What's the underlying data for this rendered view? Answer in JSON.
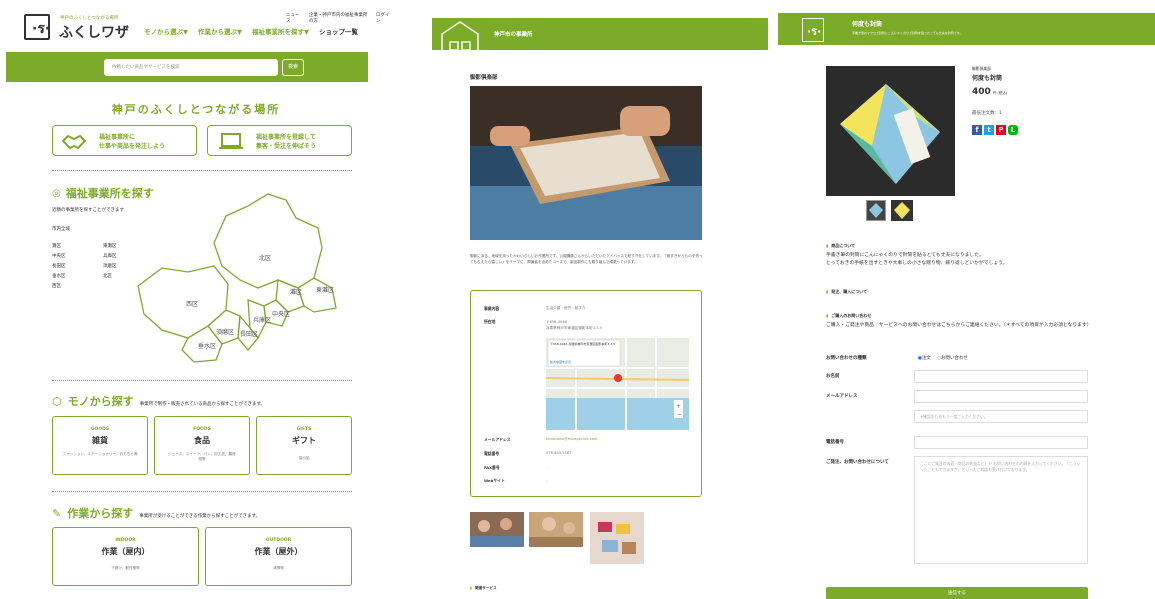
{
  "home": {
    "logo_caption": "神戸のふくしとつながる場所",
    "logo_text": "ふくしワザ",
    "util_links": [
      "ニュース",
      "企業・神戸市内の福祉事業所の方",
      "ログイン"
    ],
    "nav": [
      "モノから選ぶ",
      "作業から選ぶ",
      "福祉事業所を探す",
      "ショップ一覧"
    ],
    "search_placeholder": "依頼したい商品やサービスを検索",
    "search_button": "検索",
    "tagline": "神戸のふくしとつながる場所",
    "cta1": {
      "line1": "福祉事業所に",
      "line2": "仕事や商品を発注しよう"
    },
    "cta2": {
      "line1": "福祉事業所を登録して",
      "line2": "集客・受注を伸ばそう"
    },
    "find_office_title": "福祉事業所を探す",
    "find_office_sub": "近隣の事業所を探すことができます",
    "city_all": "市内全域",
    "wards_col1": [
      "灘区",
      "中央区",
      "長田区",
      "垂水区",
      "西区"
    ],
    "wards_col2": [
      "東灘区",
      "兵庫区",
      "須磨区",
      "北区"
    ],
    "map_labels": [
      "北区",
      "西区",
      "灘区",
      "東灘区",
      "中央区",
      "兵庫区",
      "長田区",
      "須磨区",
      "垂水区"
    ],
    "goods_title": "モノから探す",
    "goods_sub": "事業所で制作・販売されている商品から探すことができます。",
    "goods_cards": [
      {
        "en": "GOODS",
        "ja": "雑貨",
        "desc": "ファッション、ステーショナリー、おもちゃ等"
      },
      {
        "en": "FOODS",
        "ja": "食品",
        "desc": "ジュース、スイーツ、パン、加工品、農産物等"
      },
      {
        "en": "GIFTS",
        "ja": "ギフト",
        "desc": "抽出品"
      }
    ],
    "work_title": "作業から探す",
    "work_sub": "事業所が受けることができる作業から探すことができます。",
    "work_cards": [
      {
        "en": "INDOOR",
        "ja": "作業（屋内）",
        "desc": "下請け、軽作業等"
      },
      {
        "en": "OUTDOOR",
        "ja": "作業（屋外）",
        "desc": "清掃等"
      }
    ]
  },
  "office": {
    "header_title": "神戸市の事業所",
    "office_name": "御影倶楽部",
    "description": "御影にある、地域を持ったかわいらしいお作業所です。公園講師さんからいただいたアドバイスで紙すきをしています。「紙すきからものを作ってもらえたら嬉しい」をテーマに、障害者を含めたコースで、製品制作にも取り組んで頑張っています。",
    "info_rows": [
      {
        "label": "事業内容",
        "value": "生活介護・就労・紙すき"
      },
      {
        "label": "所在地",
        "value": "〒658-0046\n兵庫県神戸市東灘区御影本町3-3-5"
      },
      {
        "label": "メールアドレス",
        "value": "kinokusha@mikageclub.com"
      },
      {
        "label": "電話番号",
        "value": "078-843-5567"
      },
      {
        "label": "FAX番号",
        "value": "-"
      },
      {
        "label": "Webサイト",
        "value": "-"
      }
    ],
    "map_popup": "〒658-0046 兵庫県神戸市東灘区御影本町3-3-5",
    "map_link": "拡大地図を表示",
    "footer_label": "関連サービス"
  },
  "product": {
    "header_title": "何度も封筒",
    "header_sub": "手書き筆のマクロで封筒にこんにゃくのりで封筒を貼ったとても丈夫な封筒です。",
    "shop": "御影倶楽部",
    "name": "何度も封筒",
    "price": "400",
    "price_unit": "円 (税込)",
    "stock_label": "最低注文数：1",
    "share": [
      "f",
      "t",
      "P",
      "L"
    ],
    "about_title": "商品について",
    "about_text1": "手書き筆の封筒にこんにゃくのりで封筒を貼るとても丈夫になりました。",
    "about_text2": "とっておきの手紙を出すときや大事しの小さな贈り物、繰り返しどいかがでしょう。",
    "order_title": "発注、購入について",
    "inquiry_title": "ご購入のお問い合わせ",
    "inquiry_text": "ご購入・ご発注や商品／サービスへのお問い合わせはこちらからご連絡ください。（＊すべての項目が入力必須となります）",
    "form": {
      "type_label": "お問い合わせの種類",
      "type_opt1": "注文",
      "type_opt2": "お問い合わせ",
      "name_label": "お名前",
      "email_label": "メールアドレス",
      "email_confirm_placeholder": "※確認のためもう一度ご入力ください。",
      "phone_label": "電話番号",
      "message_label": "ご発注、お問い合わせについて",
      "message_placeholder": "ここにご発注の内容（商品の数量など）や お問い合わせの内容を入力してください。「こういったこともできますか」といったご相談も受け付けております。",
      "submit": "送信する"
    }
  },
  "colors": {
    "brand": "#7cab2a",
    "facebook": "#3b5998",
    "twitter": "#1da1f2",
    "pinterest": "#e60023",
    "line": "#00b900"
  }
}
